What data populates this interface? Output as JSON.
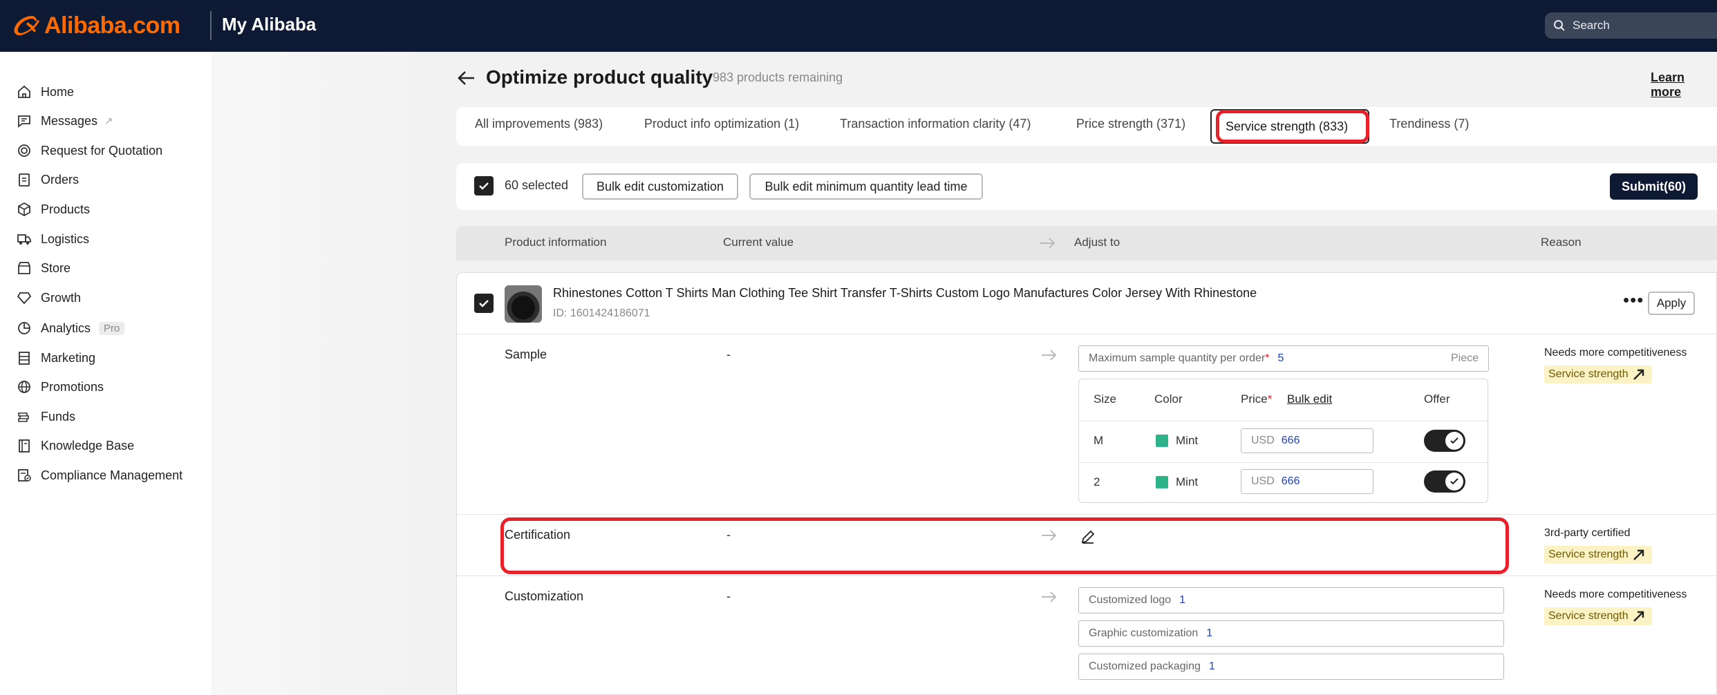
{
  "header": {
    "brand": "Alibaba.com",
    "section": "My Alibaba",
    "search_placeholder": "Search"
  },
  "sidebar": {
    "items": [
      {
        "label": "Home",
        "icon": "home-icon"
      },
      {
        "label": "Messages",
        "icon": "message-icon",
        "ext": "↗"
      },
      {
        "label": "Request for Quotation",
        "icon": "target-icon"
      },
      {
        "label": "Orders",
        "icon": "clipboard-icon"
      },
      {
        "label": "Products",
        "icon": "box-icon"
      },
      {
        "label": "Logistics",
        "icon": "truck-icon"
      },
      {
        "label": "Store",
        "icon": "store-icon"
      },
      {
        "label": "Growth",
        "icon": "diamond-icon"
      },
      {
        "label": "Analytics",
        "icon": "analytics-icon",
        "badge": "Pro"
      },
      {
        "label": "Marketing",
        "icon": "marketing-icon"
      },
      {
        "label": "Promotions",
        "icon": "globe-icon"
      },
      {
        "label": "Funds",
        "icon": "funds-icon"
      },
      {
        "label": "Knowledge Base",
        "icon": "book-icon"
      },
      {
        "label": "Compliance Management",
        "icon": "compliance-icon"
      }
    ]
  },
  "page": {
    "title": "Optimize product quality",
    "remaining": "983 products remaining",
    "learn_more": "Learn more"
  },
  "tabs": [
    {
      "label": "All improvements (983)"
    },
    {
      "label": "Product info optimization (1)"
    },
    {
      "label": "Transaction information clarity (47)"
    },
    {
      "label": "Price strength (371)"
    },
    {
      "label": "Service strength (833)",
      "active": true
    },
    {
      "label": "Trendiness (7)"
    }
  ],
  "actions": {
    "selected": "60 selected",
    "bulk_customization": "Bulk edit customization",
    "bulk_moq": "Bulk edit minimum quantity lead time",
    "submit": "Submit(60)"
  },
  "columns": {
    "product": "Product information",
    "current": "Current value",
    "adjust": "Adjust to",
    "reason": "Reason"
  },
  "product": {
    "name": "Rhinestones Cotton T Shirts Man Clothing Tee Shirt Transfer T-Shirts Custom Logo Manufactures Color Jersey With Rhinestone",
    "id": "ID: 1601424186071",
    "apply": "Apply",
    "rows": {
      "sample": {
        "label": "Sample",
        "current": "-",
        "max_label": "Maximum sample quantity per order",
        "req": "*",
        "max_value": "5",
        "unit": "Piece",
        "table": {
          "size": "Size",
          "color": "Color",
          "price": "Price",
          "price_req": "*",
          "bulk": "Bulk edit",
          "offer": "Offer",
          "rows": [
            {
              "size": "M",
              "color": "Mint",
              "currency": "USD",
              "price": "666",
              "offer": true
            },
            {
              "size": "2",
              "color": "Mint",
              "currency": "USD",
              "price": "666",
              "offer": true
            }
          ]
        },
        "reason": "Needs more competitiveness",
        "badge": "Service strength"
      },
      "certification": {
        "label": "Certification",
        "current": "-",
        "reason": "3rd-party certified",
        "badge": "Service strength"
      },
      "customization": {
        "label": "Customization",
        "current": "-",
        "fields": [
          {
            "label": "Customized logo",
            "value": "1"
          },
          {
            "label": "Graphic customization",
            "value": "1"
          },
          {
            "label": "Customized packaging",
            "value": "1"
          }
        ],
        "reason": "Needs more competitiveness",
        "badge": "Service strength"
      }
    }
  },
  "colors": {
    "topbar": "#0e1a33",
    "brand_orange": "#ff6a00",
    "highlight_red": "#e8212a",
    "badge_bg": "#fbf3c6",
    "swatch_mint": "#2eb28a"
  }
}
